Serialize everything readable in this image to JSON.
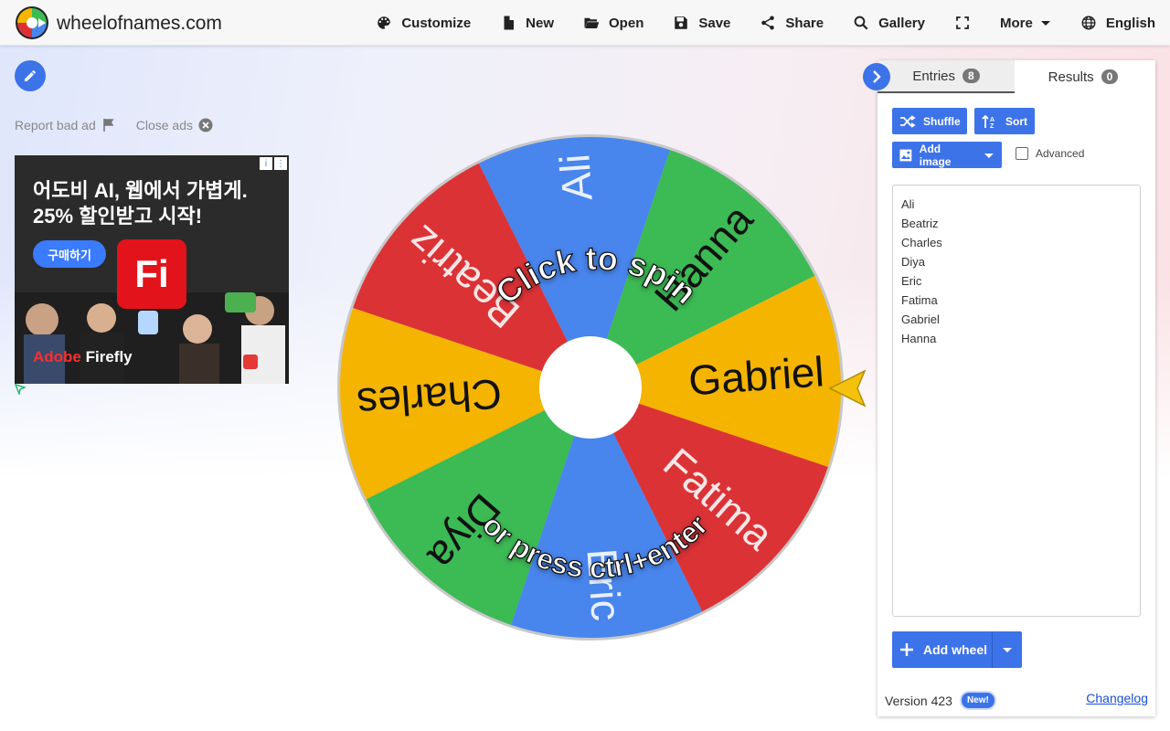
{
  "site": {
    "title": "wheelofnames.com"
  },
  "nav": {
    "customize": "Customize",
    "new": "New",
    "open": "Open",
    "save": "Save",
    "share": "Share",
    "gallery": "Gallery",
    "more": "More",
    "language": "English"
  },
  "ads": {
    "report": "Report bad ad",
    "close": "Close ads",
    "headline_line1": "어도비 AI, 웹에서 가볍게.",
    "headline_line2": "25% 할인받고 시작!",
    "cta": "구매하기",
    "logo_text": "Fi",
    "brand_red": "Adobe",
    "brand_white": " Firefly"
  },
  "wheel": {
    "overlay_top": "Click to spin",
    "overlay_bottom": "or press ctrl+enter",
    "segments": [
      {
        "name": "Gabriel",
        "color": "#f4b400"
      },
      {
        "name": "Fatima",
        "color": "#db3236"
      },
      {
        "name": "Eric",
        "color": "#4885ed"
      },
      {
        "name": "Diya",
        "color": "#3cba54"
      },
      {
        "name": "Charles",
        "color": "#f4b400"
      },
      {
        "name": "Beatriz",
        "color": "#db3236"
      },
      {
        "name": "Ali",
        "color": "#4885ed"
      },
      {
        "name": "Hanna",
        "color": "#3cba54"
      }
    ]
  },
  "panel": {
    "tab_entries": "Entries",
    "tab_entries_count": "8",
    "tab_results": "Results",
    "tab_results_count": "0",
    "shuffle": "Shuffle",
    "sort": "Sort",
    "add_image": "Add image",
    "advanced": "Advanced",
    "entries": [
      "Ali",
      "Beatriz",
      "Charles",
      "Diya",
      "Eric",
      "Fatima",
      "Gabriel",
      "Hanna"
    ],
    "add_wheel": "Add wheel",
    "version": "Version 423",
    "new_badge": "New!",
    "changelog": "Changelog"
  },
  "colors": {
    "accent": "#3d73e8"
  }
}
